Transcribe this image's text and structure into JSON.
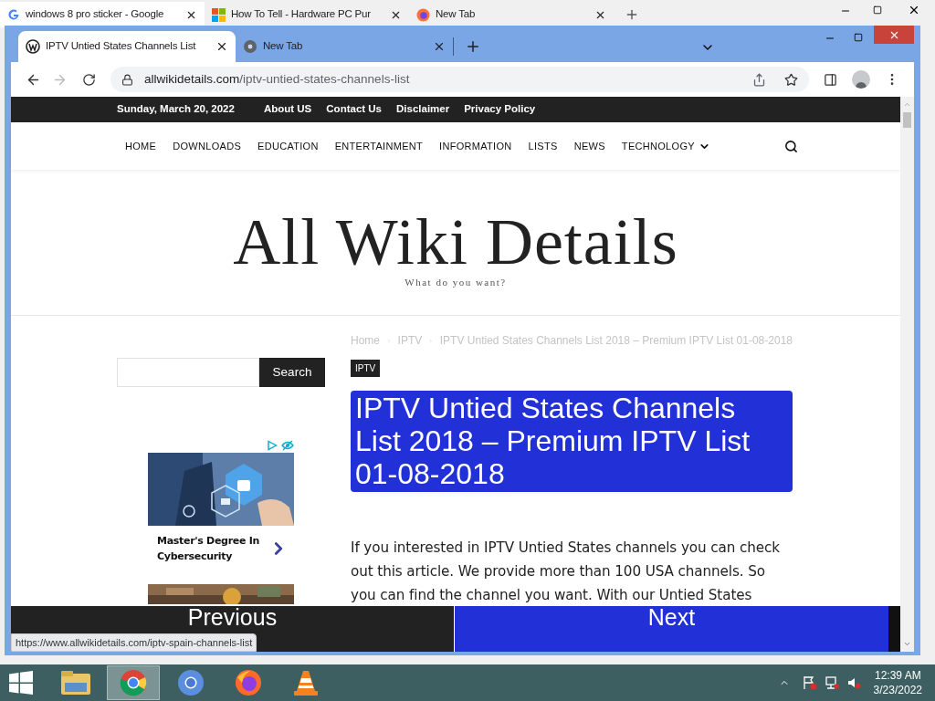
{
  "outer_browser": {
    "tabs": [
      {
        "title": "windows 8 pro sticker - Google",
        "selected": true,
        "kind": "google"
      },
      {
        "title": "How To Tell - Hardware PC Pur",
        "selected": false,
        "kind": "windows"
      },
      {
        "title": "New Tab",
        "selected": false,
        "kind": "firefox"
      }
    ]
  },
  "browser": {
    "tabs": [
      {
        "title": "IPTV Untied States Channels List",
        "selected": true,
        "kind": "wordpress"
      },
      {
        "title": "New Tab",
        "selected": false,
        "kind": "chrome"
      }
    ],
    "address": {
      "domain": "allwikidetails.com",
      "path": "/iptv-untied-states-channels-list"
    }
  },
  "site": {
    "top_bar": {
      "date": "Sunday, March 20, 2022",
      "links": [
        "About US",
        "Contact Us",
        "Disclaimer",
        "Privacy Policy"
      ]
    },
    "nav": [
      {
        "label": "HOME",
        "dropdown": false
      },
      {
        "label": "DOWNLOADS",
        "dropdown": false
      },
      {
        "label": "EDUCATION",
        "dropdown": false
      },
      {
        "label": "ENTERTAINMENT",
        "dropdown": false
      },
      {
        "label": "INFORMATION",
        "dropdown": false
      },
      {
        "label": "LISTS",
        "dropdown": false
      },
      {
        "label": "NEWS",
        "dropdown": false
      },
      {
        "label": "TECHNOLOGY",
        "dropdown": true
      }
    ],
    "logo": {
      "title": "All Wiki Details",
      "tagline": "What do you want?"
    },
    "breadcrumb": [
      "Home",
      "IPTV",
      "IPTV Untied States Channels List 2018 – Premium IPTV List 01-08-2018"
    ],
    "sidebar": {
      "search_button": "Search",
      "ad": {
        "title": "Master's Degree In Cybersecurity"
      }
    },
    "article": {
      "category": "IPTV",
      "title": "IPTV Untied States Channels List 2018 – Premium IPTV List 01-08-2018",
      "body": "If you interested in IPTV Untied States channels you can check out this article. We provide more than 100 USA channels. So you can find the channel you want. With our Untied States"
    },
    "post_nav": {
      "previous": "Previous",
      "next": "Next"
    }
  },
  "status_bar": {
    "url": "https://www.allwikidetails.com/iptv-spain-channels-list"
  },
  "taskbar": {
    "apps": [
      {
        "kind": "explorer",
        "selected": false
      },
      {
        "kind": "chrome",
        "selected": true
      },
      {
        "kind": "chromium",
        "selected": false
      },
      {
        "kind": "firefox",
        "selected": false
      },
      {
        "kind": "vlc",
        "selected": false
      }
    ],
    "time": "12:39 AM",
    "date": "3/23/2022"
  }
}
